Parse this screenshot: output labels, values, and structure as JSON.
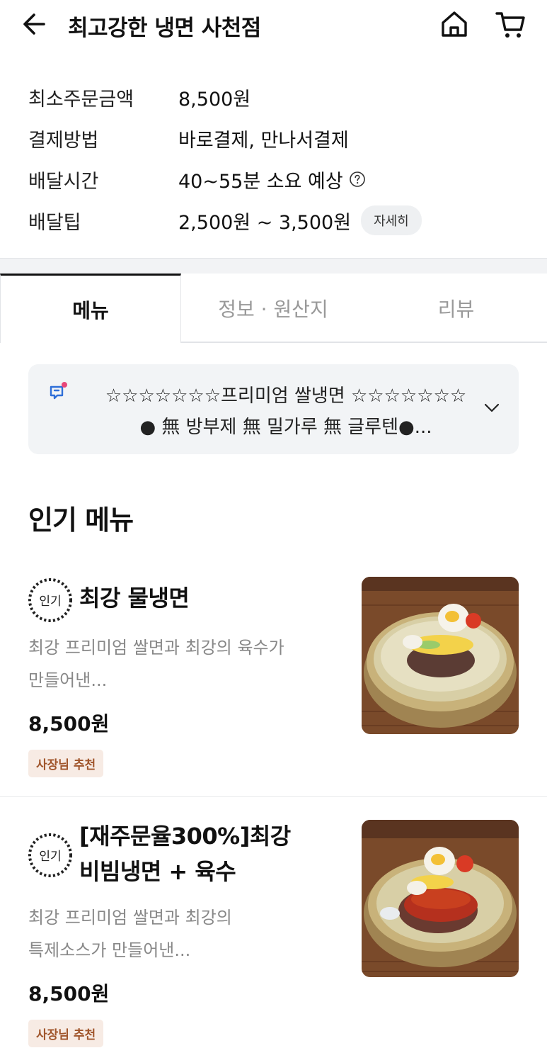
{
  "header": {
    "title": "최고강한 냉면 사천점"
  },
  "store_info": {
    "rows": [
      {
        "label": "최소주문금액",
        "value": "8,500원"
      },
      {
        "label": "결제방법",
        "value": "바로결제, 만나서결제"
      },
      {
        "label": "배달시간",
        "value": "40~55분 소요 예상"
      },
      {
        "label": "배달팁",
        "value": "2,500원 ~ 3,500원"
      }
    ],
    "detail_button": "자세히"
  },
  "tabs": [
    {
      "label": "메뉴"
    },
    {
      "label": "정보 · 원산지"
    },
    {
      "label": "리뷰"
    }
  ],
  "notice": {
    "line1": "☆☆☆☆☆☆☆프리미엄 쌀냉면 ☆☆☆☆☆☆☆",
    "line2": "● 無 방부제  無 밀가루  無 글루텐●..."
  },
  "popular": {
    "section_title": "인기 메뉴",
    "badge_text": "인기",
    "items": [
      {
        "name_line1": "최강 물냉면",
        "name_line2": "",
        "desc_line1": "최강 프리미엄 쌀면과 최강의 육수가",
        "desc_line2": "만들어낸...",
        "price": "8,500원",
        "badge": "사장님 추천"
      },
      {
        "name_line1": "[재주문율300%]최강",
        "name_line2": "비빔냉면 + 육수",
        "desc_line1": "최강  프리미엄 쌀면과 최강의",
        "desc_line2": "특제소스가 만들어낸...",
        "price": "8,500원",
        "badge": "사장님 추천"
      }
    ]
  },
  "colors": {
    "accent_pink": "#e8477a",
    "badge_bg": "#f7ebe4",
    "badge_text": "#a0552b",
    "notice_bg": "#f2f4f6"
  }
}
